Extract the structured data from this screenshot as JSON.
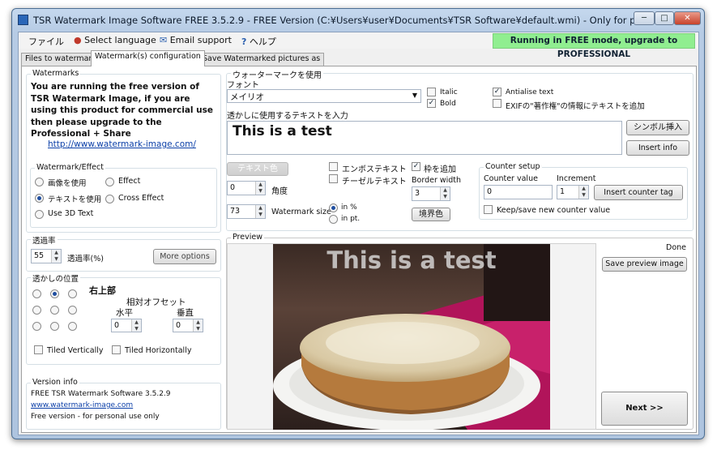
{
  "window": {
    "title": "TSR Watermark Image Software FREE 3.5.2.9 - FREE Version (C:¥Users¥user¥Documents¥TSR Software¥default.wmi) - Only for personal use!",
    "minimize": "─",
    "maximize": "□",
    "close": "✕"
  },
  "menu": {
    "file": "ファイル",
    "language": "Select language",
    "email": "Email support",
    "help": "ヘルプ",
    "upgrade": "Running in FREE mode, upgrade to PROFESSIONAL"
  },
  "tabs": [
    "Files to watermark",
    "Watermark(s) configuration",
    "Save Watermarked pictures as"
  ],
  "watermarks": {
    "label": "Watermarks",
    "notice": "You are running the free version of TSR Watermark Image, if you are using this product for commercial use then please upgrade to the Professional + Share",
    "link": "http://www.watermark-image.com/"
  },
  "effect": {
    "label": "Watermark/Effect",
    "image": "画像を使用",
    "text": "テキストを使用",
    "three_d": "Use 3D Text",
    "effect": "Effect",
    "cross": "Cross Effect"
  },
  "opacity": {
    "label": "透過率",
    "value": "55",
    "unit": "透過率(%)",
    "more": "More options"
  },
  "position": {
    "label": "透かしの位置",
    "selected": "右上部",
    "offset": "相対オフセット",
    "horizontal": "水平",
    "vertical": "垂直",
    "h_value": "0",
    "v_value": "0",
    "tiled_v": "Tiled Vertically",
    "tiled_h": "Tiled Horizontally"
  },
  "version": {
    "label": "Version info",
    "line1": "FREE TSR Watermark Software 3.5.2.9",
    "link": "www.watermark-image.com",
    "line3": "Free version - for personal use only"
  },
  "wm": {
    "group": "ウォーターマークを使用",
    "font_label": "フォント",
    "font": "メイリオ",
    "italic": "Italic",
    "bold": "Bold",
    "antialias": "Antialise text",
    "exif": "EXIFの\"著作権\"の情報にテキストを追加",
    "text_label": "透かしに使用するテキストを入力",
    "text": "This is a test",
    "symbol": "シンボル挿入",
    "insert_info": "Insert info",
    "text_color": "テキスト色",
    "angle": "0",
    "angle_label": "角度",
    "size": "73",
    "size_label": "Watermark size",
    "in_pct": "in %",
    "in_pt": "in pt.",
    "emboss": "エンボステキスト",
    "chisel": "チーゼルテキスト",
    "border": "枠を追加",
    "border_width_label": "Border width",
    "border_width": "3",
    "border_color": "境界色"
  },
  "counter": {
    "label": "Counter setup",
    "value_label": "Counter value",
    "value": "0",
    "inc_label": "Increment",
    "inc": "1",
    "insert": "Insert counter tag",
    "keep": "Keep/save new counter value"
  },
  "preview": {
    "label": "Preview",
    "watermark": "This is a test",
    "status": "Done",
    "save": "Save preview image",
    "next": "Next >>"
  },
  "colors": {
    "upgrade_bg": "#90ee90",
    "title_bg": "#c5d8ee",
    "link": "#0b3fa8"
  }
}
